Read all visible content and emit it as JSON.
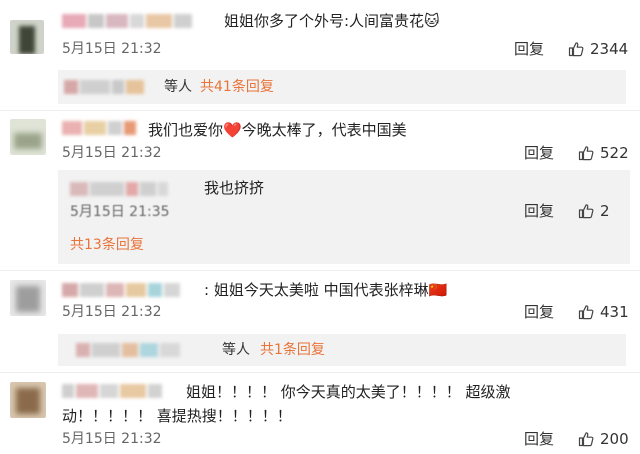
{
  "colors": {
    "accent": "#e8743a",
    "muted": "#666666",
    "text": "#222222",
    "subbox": "#f2f2f2"
  },
  "comments": [
    {
      "text": "姐姐你多了个外号:人间富贵花🐱",
      "time": "5月15日 21:32",
      "reply": "回复",
      "likes": "2344",
      "replies_summary": {
        "who": "等人",
        "count": "共41条回复"
      }
    },
    {
      "text": "我们也爱你❤️今晚太棒了，代表中国美",
      "time": "5月15日 21:32",
      "reply": "回复",
      "likes": "522",
      "subreply": {
        "text": "我也挤挤",
        "time": "5月15日 21:35",
        "reply": "回复",
        "likes": "2"
      },
      "replies_summary": {
        "count": "共13条回复"
      }
    },
    {
      "text": ": 姐姐今天太美啦 中国代表张梓琳🇨🇳",
      "time": "5月15日 21:32",
      "reply": "回复",
      "likes": "431",
      "replies_summary": {
        "who": "等人",
        "count": "共1条回复"
      }
    },
    {
      "text_line1": "姐姐！！！！ 你今天真的太美了！！！！ 超级激",
      "text_line2": "动！！！！！ 喜提热搜！！！！！",
      "time": "5月15日 21:32",
      "reply": "回复",
      "likes": "200"
    }
  ]
}
